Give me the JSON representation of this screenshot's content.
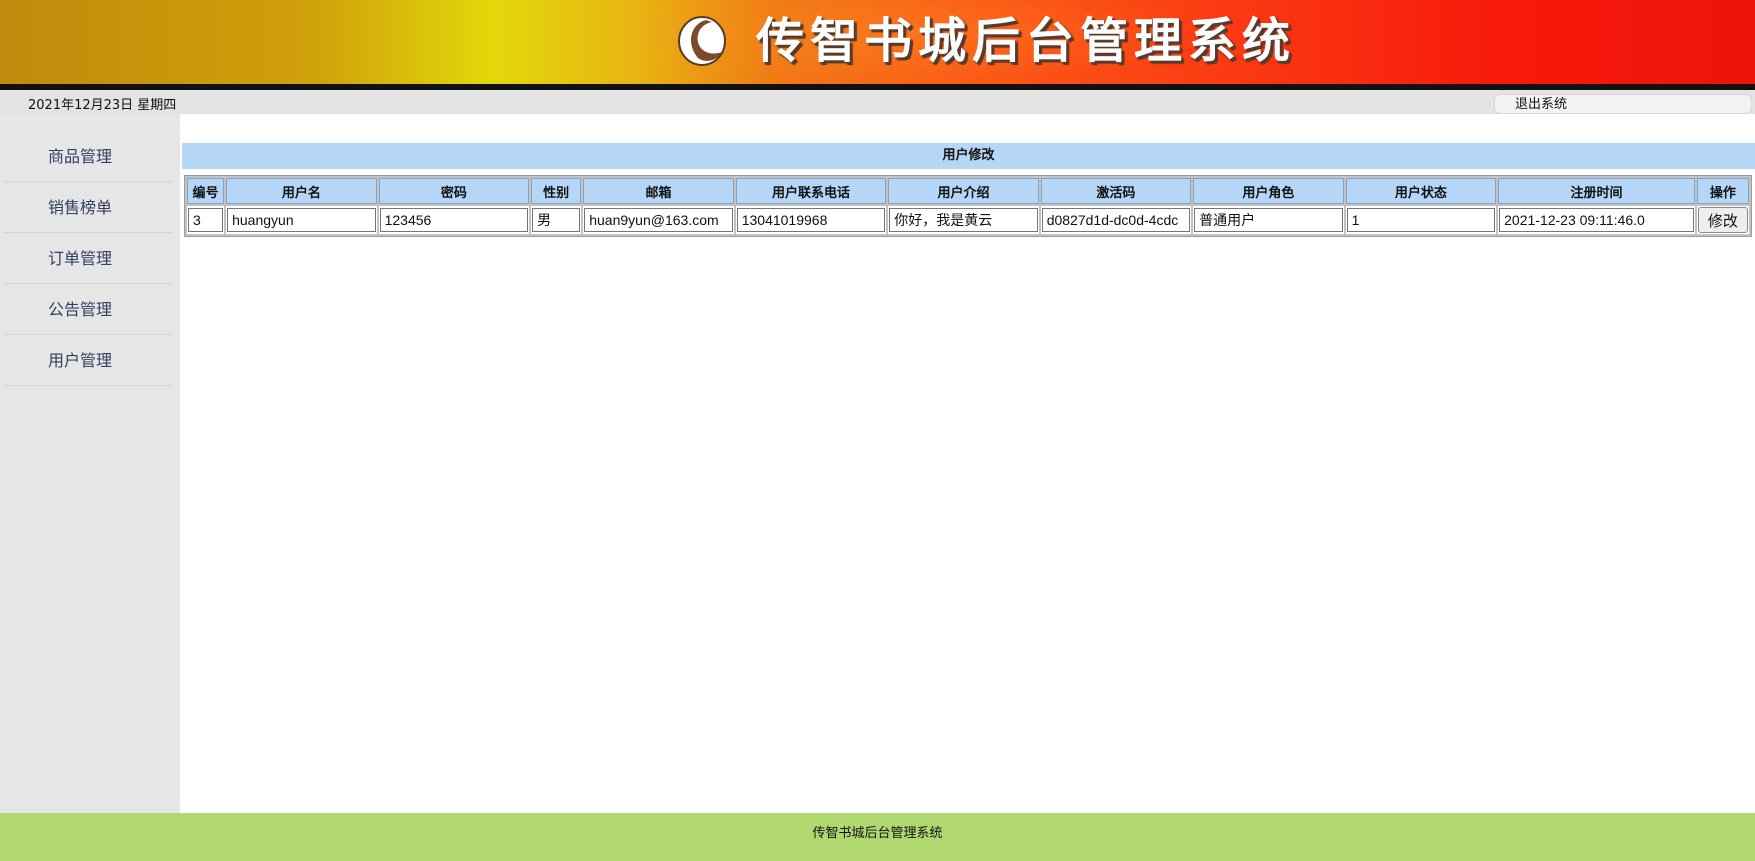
{
  "header": {
    "title": "传智书城后台管理系统",
    "colors": {
      "banner_left": "#c08a0c",
      "banner_mid": "#e2d80a",
      "banner_right": "#ee1208"
    }
  },
  "infobar": {
    "date": "2021年12月23日 星期四",
    "logout_label": "退出系统"
  },
  "sidebar": {
    "items": [
      {
        "label": "商品管理"
      },
      {
        "label": "销售榜单"
      },
      {
        "label": "订单管理"
      },
      {
        "label": "公告管理"
      },
      {
        "label": "用户管理"
      }
    ]
  },
  "main": {
    "title": "用户修改",
    "columns": [
      "编号",
      "用户名",
      "密码",
      "性别",
      "邮箱",
      "用户联系电话",
      "用户介绍",
      "激活码",
      "用户角色",
      "用户状态",
      "注册时间",
      "操作"
    ],
    "row": {
      "id": "3",
      "username": "huangyun",
      "password": "123456",
      "gender": "男",
      "email": "huan9yun@163.com",
      "phone": "13041019968",
      "intro": "你好，我是黄云",
      "activation_code": "d0827d1d-dc0d-4cdc",
      "role": "普通用户",
      "state": "1",
      "register_time": "2021-12-23 09:11:46.0",
      "action_label": "修改"
    }
  },
  "footer": {
    "text": "传智书城后台管理系统",
    "color": "#b1d771"
  }
}
